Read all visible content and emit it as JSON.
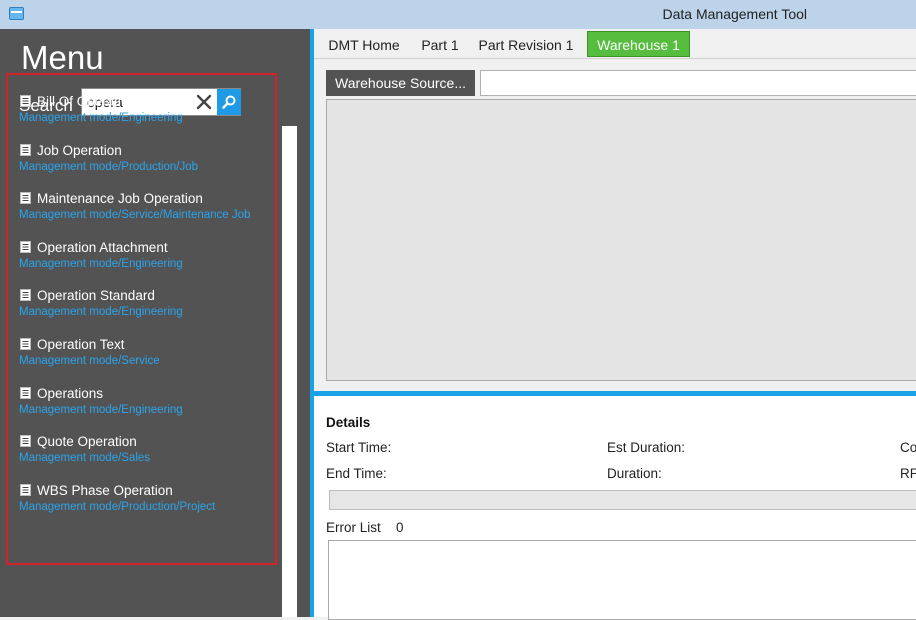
{
  "window": {
    "title": "Data Management Tool"
  },
  "sidebar": {
    "title": "Menu",
    "search": {
      "label": "Search",
      "value": "opera"
    },
    "results": [
      {
        "title": "Bill Of Operations",
        "path": "Management mode/Engineering"
      },
      {
        "title": "Job Operation",
        "path": "Management mode/Production/Job"
      },
      {
        "title": "Maintenance Job Operation",
        "path": "Management mode/Service/Maintenance Job"
      },
      {
        "title": "Operation Attachment",
        "path": "Management mode/Engineering"
      },
      {
        "title": "Operation Standard",
        "path": "Management mode/Engineering"
      },
      {
        "title": "Operation Text",
        "path": "Management mode/Service"
      },
      {
        "title": "Operations",
        "path": "Management mode/Engineering"
      },
      {
        "title": "Quote Operation",
        "path": "Management mode/Sales"
      },
      {
        "title": "WBS Phase Operation",
        "path": "Management mode/Production/Project"
      }
    ]
  },
  "tabs": [
    {
      "label": "DMT Home",
      "active": false
    },
    {
      "label": "Part 1",
      "active": false
    },
    {
      "label": "Part Revision 1",
      "active": false
    },
    {
      "label": "Warehouse 1",
      "active": true
    }
  ],
  "toolbar": {
    "source_button": "Warehouse Source..."
  },
  "details": {
    "heading": "Details",
    "start_time_label": "Start Time:",
    "end_time_label": "End Time:",
    "est_duration_label": "Est Duration:",
    "duration_label": "Duration:",
    "col3_row1_label": "Co",
    "col3_row2_label": "RP",
    "error_list_label": "Error List",
    "error_count": "0"
  },
  "icons": {
    "app": "app-window-icon",
    "clear": "close-icon",
    "search": "search-icon",
    "item": "document-icon"
  },
  "colors": {
    "accent": "#1aa2e6",
    "active_tab": "#56bd3e",
    "sidebar": "#535353",
    "highlight_border": "#d0242a",
    "path_text": "#2aa5ee"
  }
}
